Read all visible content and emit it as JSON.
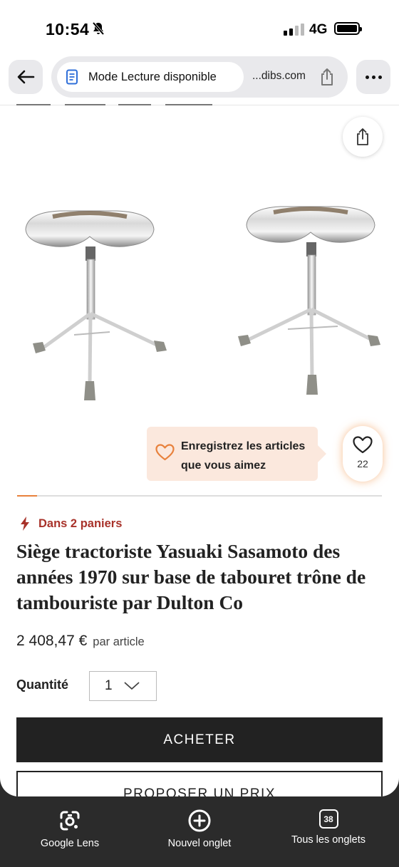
{
  "status_bar": {
    "time": "10:54",
    "network": "4G"
  },
  "browser": {
    "reader_label": "Mode Lecture disponible",
    "domain": "...dibs.com"
  },
  "product": {
    "tooltip_text": "Enregistrez les articles que vous aimez",
    "favorites_count": "22",
    "carousel_progress": 0.055,
    "carts_text": "Dans 2 paniers",
    "title": "Siège tractoriste Yasuaki Sasamoto des années 1970 sur base de tabouret trône de tambouriste par Dulton Co",
    "price": "2 408,47 €",
    "price_unit": "par article",
    "quantity_label": "Quantité",
    "quantity_value": "1",
    "buy_label": "ACHETER",
    "offer_label": "PROPOSER UN PRIX"
  },
  "toolbar": {
    "lens_label": "Google Lens",
    "new_tab_label": "Nouvel onglet",
    "tabs_label": "Tous les onglets",
    "tabs_count": "38"
  },
  "colors": {
    "accent_orange": "#e8813c",
    "carts_red": "#a8322a",
    "tooltip_bg": "#fbe8dd",
    "button_dark": "#222222"
  },
  "icons": [
    "back-arrow-icon",
    "reader-doc-icon",
    "share-icon",
    "more-dots-icon",
    "heart-icon",
    "lightning-icon",
    "chevron-down-icon",
    "lens-icon",
    "plus-circle-icon",
    "tabs-icon",
    "bell-slash-icon"
  ]
}
